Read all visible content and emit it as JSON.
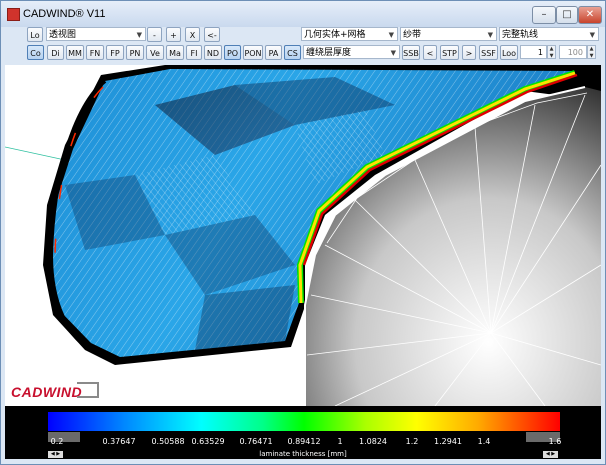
{
  "window": {
    "title": "CADWIND® V11",
    "minimize": "–",
    "maximize": "□",
    "close": "✕"
  },
  "toolbar": {
    "row1": {
      "lo_button": "Lo",
      "view_select": "透视图",
      "minus_button": "-",
      "plus_button": "+",
      "x_button": "X",
      "back_button": "<-",
      "display_select": "几何实体+网格",
      "band_select": "纱带",
      "path_select": "完整轨线"
    },
    "row2": {
      "buttons": [
        "Co",
        "Di",
        "MM",
        "FN",
        "FP",
        "PN",
        "Ve",
        "Ma",
        "FI",
        "ND",
        "PO",
        "PON",
        "PA",
        "CS"
      ],
      "thickness_select": "缠绕层厚度",
      "ssb_button": "SSB",
      "prev_button": "<",
      "stp_button": "STP",
      "next_button": ">",
      "ssf_button": "SSF",
      "loo_button": "Loo",
      "loop_value": "1",
      "percent_value": "100"
    }
  },
  "logo": {
    "text": "CADWIND"
  },
  "legend": {
    "ticks": [
      "0.2",
      "0.37647",
      "0.50588",
      "0.63529",
      "0.76471",
      "0.89412",
      "1",
      "1.0824",
      "1.2",
      "1.2941",
      "1.4",
      "1.6"
    ],
    "title": "laminate thickness [mm]",
    "left_arrows": "◀ ▶",
    "right_arrows": "◀ ▶",
    "gradient_colors": [
      "#0000ff",
      "#0088ff",
      "#00ffff",
      "#00ff88",
      "#00ff00",
      "#aaff00",
      "#ffff00",
      "#ffaa00",
      "#ff0000"
    ]
  }
}
